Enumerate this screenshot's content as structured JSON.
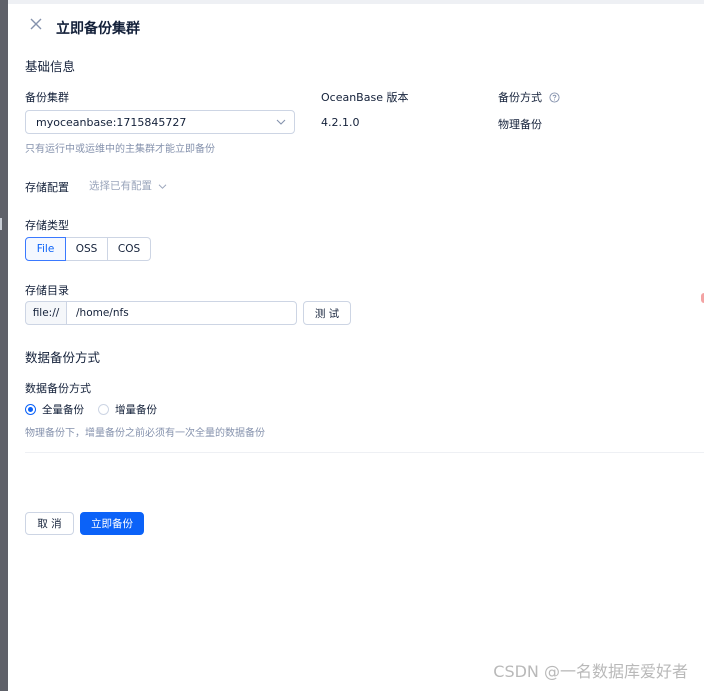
{
  "header": {
    "title": "立即备份集群",
    "close_icon": "close-icon"
  },
  "basic_info": {
    "section_title": "基础信息",
    "cluster_label": "备份集群",
    "cluster_value": "myoceanbase:1715845727",
    "cluster_hint": "只有运行中或运维中的主集群才能立即备份",
    "version_label": "OceanBase 版本",
    "version_value": "4.2.1.0",
    "method_label": "备份方式",
    "method_value": "物理备份"
  },
  "storage": {
    "config_label": "存储配置",
    "config_placeholder": "选择已有配置",
    "type_label": "存储类型",
    "types": [
      "File",
      "OSS",
      "COS"
    ],
    "selected_type": "File",
    "dir_label": "存储目录",
    "dir_prefix": "file://",
    "dir_value": "/home/nfs",
    "test_button": "测 试"
  },
  "data_backup": {
    "section_title": "数据备份方式",
    "method_label": "数据备份方式",
    "options": [
      "全量备份",
      "增量备份"
    ],
    "selected": "全量备份",
    "hint": "物理备份下，增量备份之前必须有一次全量的数据备份"
  },
  "footer": {
    "cancel_label": "取 消",
    "submit_label": "立即备份"
  },
  "watermark": "CSDN @一名数据库爱好者",
  "colors": {
    "primary": "#0b62f8",
    "text": "#132039",
    "hint": "#8592ad",
    "border": "#cdd5e4"
  }
}
